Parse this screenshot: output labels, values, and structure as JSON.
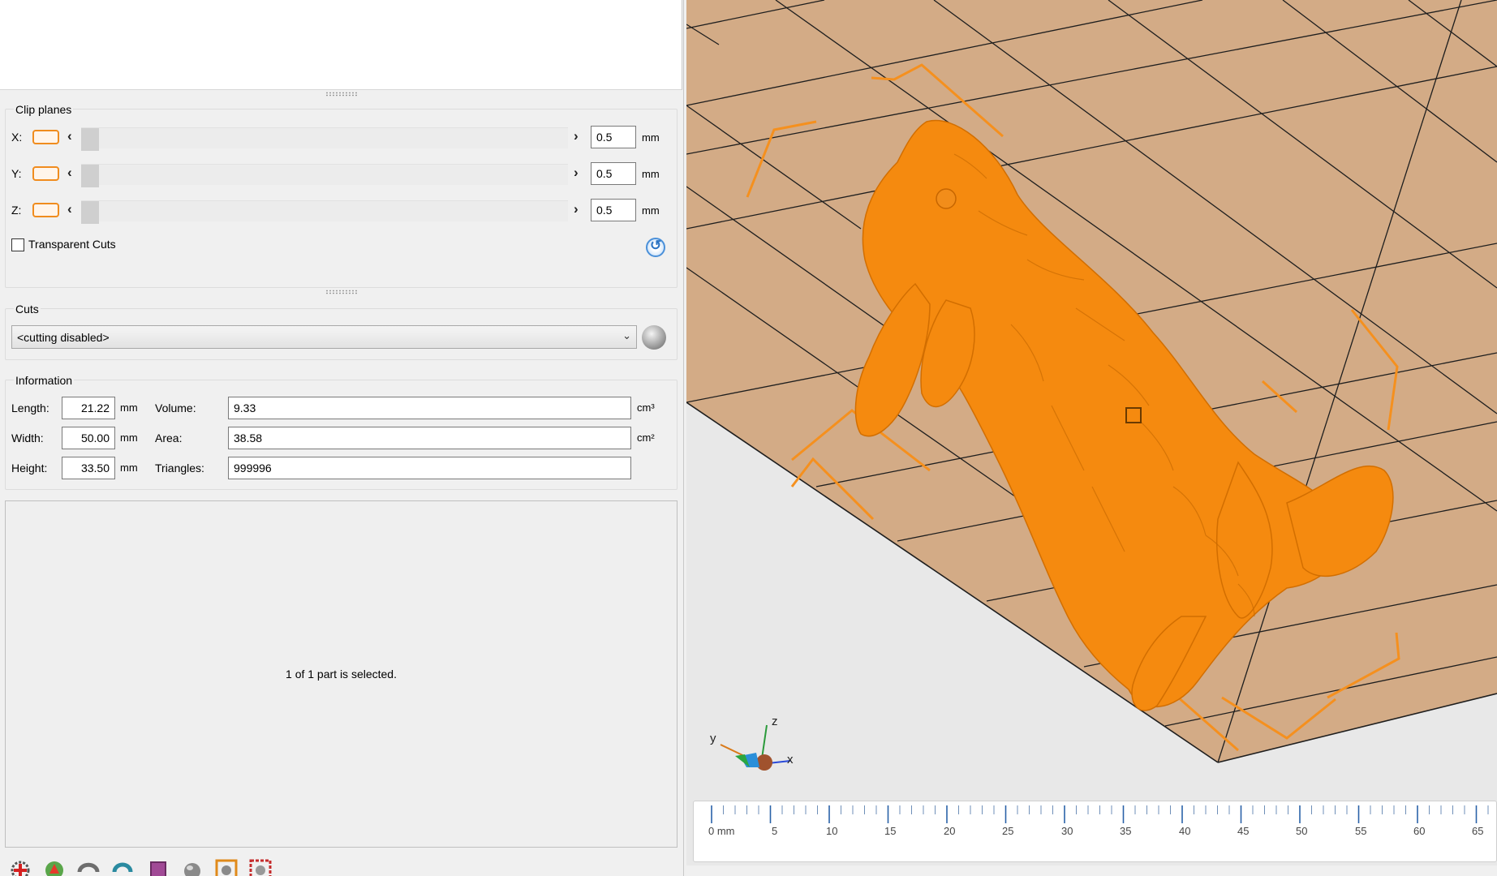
{
  "clip_planes": {
    "title": "Clip planes",
    "rows": [
      {
        "axis": "X:",
        "value": "0.5",
        "unit": "mm"
      },
      {
        "axis": "Y:",
        "value": "0.5",
        "unit": "mm"
      },
      {
        "axis": "Z:",
        "value": "0.5",
        "unit": "mm"
      }
    ],
    "transparent_cuts_label": "Transparent Cuts",
    "transparent_cuts_checked": false
  },
  "cuts": {
    "title": "Cuts",
    "selected": "<cutting disabled>"
  },
  "information": {
    "title": "Information",
    "length_label": "Length:",
    "length_value": "21.22",
    "length_unit": "mm",
    "width_label": "Width:",
    "width_value": "50.00",
    "width_unit": "mm",
    "height_label": "Height:",
    "height_value": "33.50",
    "height_unit": "mm",
    "volume_label": "Volume:",
    "volume_value": "9.33",
    "volume_unit": "cm³",
    "area_label": "Area:",
    "area_value": "38.58",
    "area_unit": "cm²",
    "triangles_label": "Triangles:",
    "triangles_value": "999996"
  },
  "status": {
    "text": "1 of 1 part is selected."
  },
  "viewport": {
    "axis_labels": {
      "x": "x",
      "y": "y",
      "z": "z"
    },
    "ruler_labels": [
      "0 mm",
      "5",
      "10",
      "15",
      "20",
      "25",
      "30",
      "35",
      "40",
      "45",
      "50",
      "55",
      "60",
      "65"
    ],
    "colors": {
      "bed": "#d3ab86",
      "model": "#f58a0f",
      "bounding_box": "#f5901e",
      "grid": "#1e1e1e"
    }
  },
  "toolbar": {
    "icons": [
      "add-part-icon",
      "repair-icon",
      "rotate-icon",
      "refresh-icon",
      "support-icon",
      "sphere-icon",
      "select-icon",
      "settings-gear-icon"
    ]
  }
}
